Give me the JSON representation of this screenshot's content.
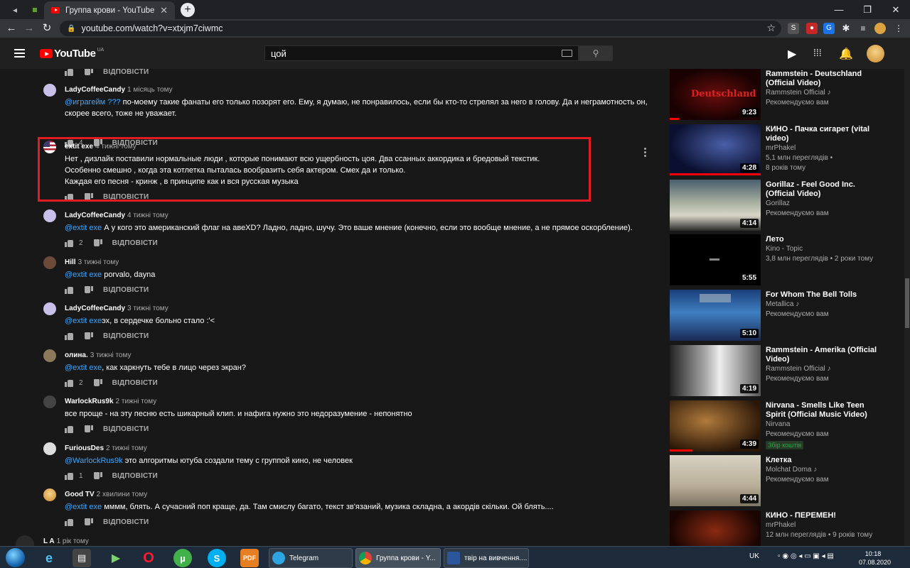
{
  "browser": {
    "tab_title": "Группа крови - YouTube",
    "url": "youtube.com/watch?v=xtxjm7ciwmc",
    "new_tab_label": "+",
    "tab_close": "✕"
  },
  "youtube": {
    "logo_text": "YouTube",
    "country": "UA",
    "search_query": "цой"
  },
  "comments": [
    {
      "author": "",
      "ago": "",
      "mention": "",
      "text": "",
      "likes": "",
      "reply": "ВІДПОВІСТИ"
    },
    {
      "author": "LadyCoffeeCandy",
      "ago": "1 місяць тому",
      "mention": "@игрaгейм ???",
      "text": " по-моему такие фанаты его только позорят его. Ему, я думаю, не понравилось, если бы кто-то стрелял за него в голову. Да и неграмотность он, скорее всего, тоже не уважает.",
      "likes": "4",
      "reply": "ВІДПОВІСТИ"
    },
    {
      "author": "extit exe",
      "ago": "4 тижні тому",
      "mention": "",
      "text": "Нет , дизлайк поставили нормальные люди , которые понимают всю ущербность цоя. Два ссанных аккордика и бредовый текстик.\nОсобенно смешно , когда эта котлетка пыталась вообразить себя актером. Смех да и только.\nКаждая его песня - кринж , в принципе как и вся русская музыка",
      "likes": "",
      "reply": "ВІДПОВІСТИ"
    },
    {
      "author": "LadyCoffeeCandy",
      "ago": "4 тижні тому",
      "mention": "@extit exe",
      "text": " А у кого это американский флаг на авеXD? Ладно, ладно, шучу. Это ваше мнение (конечно, если это вообще мнение, а не прямое оскорбление).",
      "likes": "2",
      "reply": "ВІДПОВІСТИ"
    },
    {
      "author": "Hill",
      "ago": "3 тижні тому",
      "mention": "@extit exe",
      "text": " porvalo, dayna",
      "likes": "",
      "reply": "ВІДПОВІСТИ"
    },
    {
      "author": "LadyCoffeeCandy",
      "ago": "3 тижні тому",
      "mention": "@extit exe",
      "text": "эх, в сердечке больно стало :'<",
      "likes": "",
      "reply": "ВІДПОВІСТИ"
    },
    {
      "author": "олина.",
      "ago": "3 тижні тому",
      "mention": "@extit exe",
      "text": ", как харкнуть тебе в лицо через экран?",
      "likes": "2",
      "reply": "ВІДПОВІСТИ"
    },
    {
      "author": "WarlockRus9k",
      "ago": "2 тижні тому",
      "mention": "",
      "text": "все проще - на эту песню есть шикарный клип. и нафига нужно это недоразумение - непонятно",
      "likes": "",
      "reply": "ВІДПОВІСТИ"
    },
    {
      "author": "FuriousDes",
      "ago": "2 тижні тому",
      "mention": "@WarlockRus9k",
      "text": " это алгоритмы ютуба создали тему с группой кино, не человек",
      "likes": "1",
      "reply": "ВІДПОВІСТИ"
    },
    {
      "author": "Good TV",
      "ago": "2 хвилини тому",
      "mention": "@extit exe",
      "text": " мммм, блять. А сучасний поп краще, да. Там смислу багато, текст зв'язаний, музика складна, а акордів скільки. Ой блять....",
      "likes": "",
      "reply": "ВІДПОВІСТИ"
    },
    {
      "author": "L A",
      "ago": "1 рік тому",
      "mention": "",
      "text": "",
      "likes": "",
      "reply": ""
    }
  ],
  "recommendations": [
    {
      "title": "Rammstein - Deutschland (Official Video)",
      "channel": "Rammstein Official ♪",
      "meta": "Рекомендуємо вам",
      "duration": "9:23",
      "watched": 0.1
    },
    {
      "title": "КИНО - Пачка сигарет (vital video)",
      "channel": "mrPhakel",
      "meta": "5,1 млн переглядів •",
      "meta2": "8 років тому",
      "duration": "4:28",
      "watched": 1.0
    },
    {
      "title": "Gorillaz - Feel Good Inc. (Official Video)",
      "channel": "Gorillaz",
      "meta": "Рекомендуємо вам",
      "duration": "4:14",
      "watched": 0
    },
    {
      "title": "Лето",
      "channel": "Kino - Topic",
      "meta": "3,8 млн переглядів • 2 роки тому",
      "duration": "5:55",
      "watched": 0
    },
    {
      "title": "For Whom The Bell Tolls",
      "channel": "Metallica ♪",
      "meta": "Рекомендуємо вам",
      "duration": "5:10",
      "watched": 0
    },
    {
      "title": "Rammstein - Amerika (Official Video)",
      "channel": "Rammstein Official ♪",
      "meta": "Рекомендуємо вам",
      "duration": "4:19",
      "watched": 0
    },
    {
      "title": "Nirvana - Smells Like Teen Spirit (Official Music Video)",
      "channel": "Nirvana",
      "meta": "Рекомендуємо вам",
      "badge": "Збір коштів",
      "duration": "4:39",
      "watched": 0.25
    },
    {
      "title": "Клетка",
      "channel": "Molchat Doma ♪",
      "meta": "Рекомендуємо вам",
      "duration": "4:44",
      "watched": 0
    },
    {
      "title": "КИНО - ПЕРЕМЕН!",
      "channel": "mrPhakel",
      "meta": "12 млн переглядів • 9 років тому",
      "duration": "",
      "watched": 0
    }
  ],
  "taskbar": {
    "telegram_label": "Telegram",
    "chrome_label": "Группа крови - Y...",
    "word_label": "твір на вивчення....",
    "lang": "UK",
    "time": "10:18",
    "date": "07.08.2020"
  },
  "colors": {
    "accent_red": "#ff0000",
    "mention_blue": "#3ea6ff",
    "highlight_border": "#e21c23"
  }
}
